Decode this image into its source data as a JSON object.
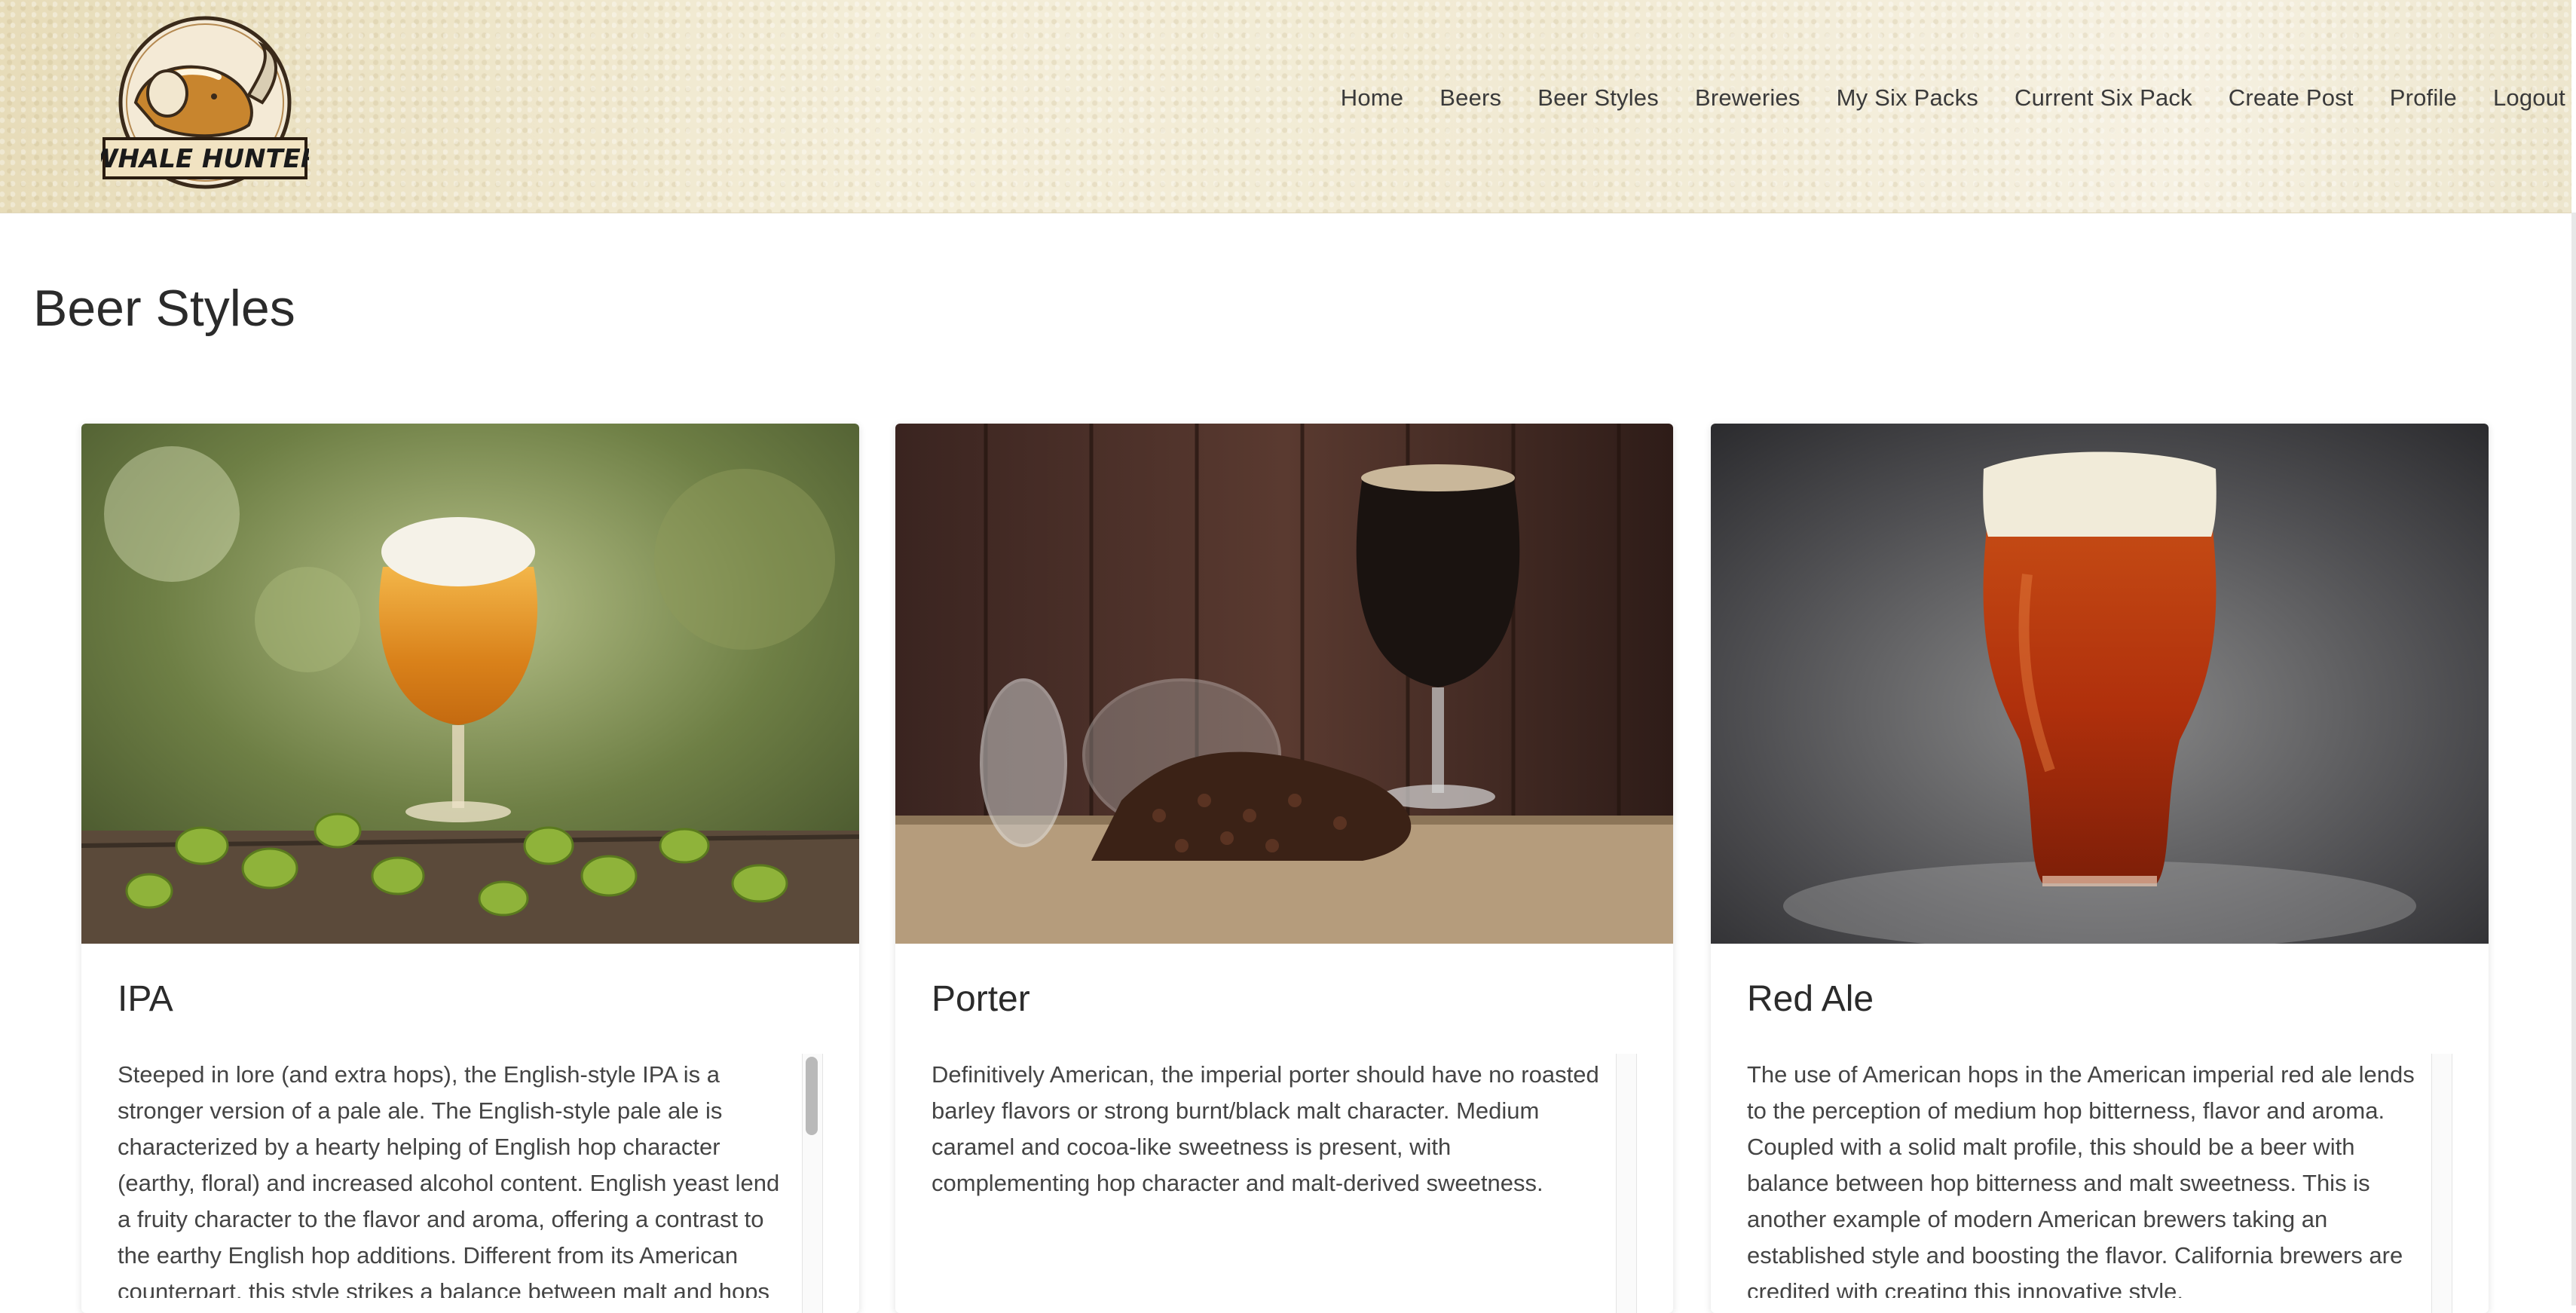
{
  "header": {
    "logo_text": "WHALE HUNTER",
    "nav": [
      "Home",
      "Beers",
      "Beer Styles",
      "Breweries",
      "My Six Packs",
      "Current Six Pack",
      "Create Post",
      "Profile",
      "Logout"
    ]
  },
  "page": {
    "title": "Beer Styles"
  },
  "cards": [
    {
      "title": "IPA",
      "description": "Steeped in lore (and extra hops), the English-style IPA is a stronger version of a pale ale. The English-style pale ale is characterized by a hearty helping of English hop character (earthy, floral) and increased alcohol content. English yeast lend a fruity character to the flavor and aroma, offering a contrast to the earthy English hop additions. Different from its American counterpart, this style strikes a balance between malt and hops"
    },
    {
      "title": "Porter",
      "description": "Definitively American, the imperial porter should have no roasted barley flavors or strong burnt/black malt character. Medium caramel and cocoa-like sweetness is present, with complementing hop character and malt-derived sweetness."
    },
    {
      "title": "Red Ale",
      "description": "The use of American hops in the American imperial red ale lends to the perception of medium hop bitterness, flavor and aroma. Coupled with a solid malt profile, this should be a beer with balance between hop bitterness and malt sweetness. This is another example of modern American brewers taking an established style and boosting the flavor. California brewers are credited with creating this innovative style."
    }
  ],
  "colors": {
    "header_bg": "#efe8cf",
    "logo_text": "#1a1a1a",
    "logo_body": "#c8852e"
  }
}
